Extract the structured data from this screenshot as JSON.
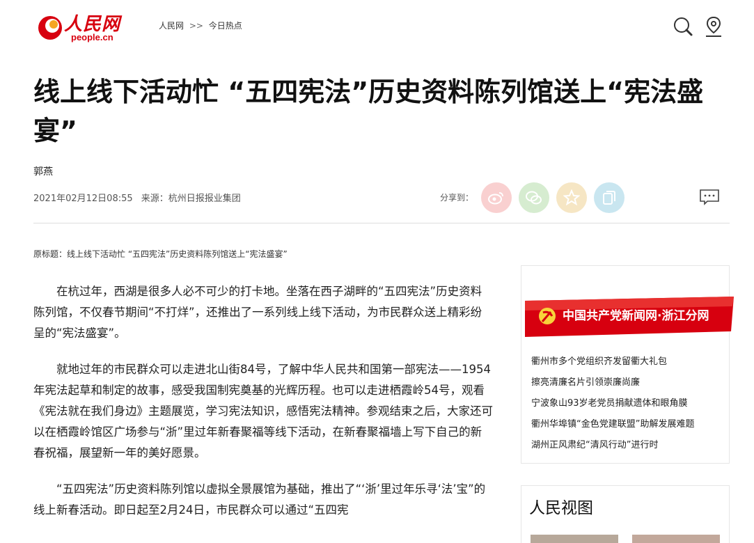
{
  "header": {
    "logo_cn": "人民网",
    "logo_en": "people.cn",
    "breadcrumb": [
      "人民网",
      ">>",
      "今日热点"
    ],
    "icons": [
      "search-icon",
      "location-icon"
    ]
  },
  "article": {
    "title": "线上线下活动忙 “五四宪法”历史资料陈列馆送上“宪法盛宴”",
    "author": "郭燕",
    "date": "2021年02月12日08:55",
    "source": "来源：杭州日报报业集团",
    "share_label": "分享到：",
    "share_icons": [
      "weibo-icon",
      "wechat-icon",
      "star-icon",
      "copy-icon"
    ],
    "original_title": "原标题：线上线下活动忙 “五四宪法”历史资料陈列馆送上“宪法盛宴”",
    "paragraphs": [
      "在杭过年，西湖是很多人必不可少的打卡地。坐落在西子湖畔的“五四宪法”历史资料陈列馆，不仅春节期间“不打烊”，还推出了一系列线上线下活动，为市民群众送上精彩纷呈的“宪法盛宴”。",
      "就地过年的市民群众可以走进北山街84号，了解中华人民共和国第一部宪法——1954年宪法起草和制定的故事，感受我国制宪奠基的光辉历程。也可以走进栖霞岭54号，观看《宪法就在我们身边》主题展览，学习宪法知识，感悟宪法精神。参观结束之后，大家还可以在栖霞岭馆区广场参与“浙”里过年新春聚福等线下活动，在新春聚福墙上写下自己的新春祝福，展望新一年的美好愿景。",
      "“五四宪法”历史资料陈列馆以虚拟全景展馆为基础，推出了“‘浙’里过年乐寻‘法’宝”的线上新春活动。即日起至2月24日，市民群众可以通过“五四宪"
    ]
  },
  "sidebar": {
    "banner_text": "中国共产党新闻网·浙江分网",
    "news": [
      "衢州市多个党组织齐发留衢大礼包",
      "擦亮清廉名片引领崇廉尚廉",
      "宁波象山93岁老党员捐献遗体和眼角膜",
      "衢州华埠镇“金色党建联盟”助解发展难题",
      "湖州正风肃纪“清风行动”进行时"
    ],
    "section_title": "人民视图"
  },
  "colors": {
    "brand_red": "#d7000f",
    "weibo": "#f9d0d0",
    "wechat": "#d6ecd0",
    "star": "#f6e6c4",
    "copy": "#c9e6f0"
  }
}
